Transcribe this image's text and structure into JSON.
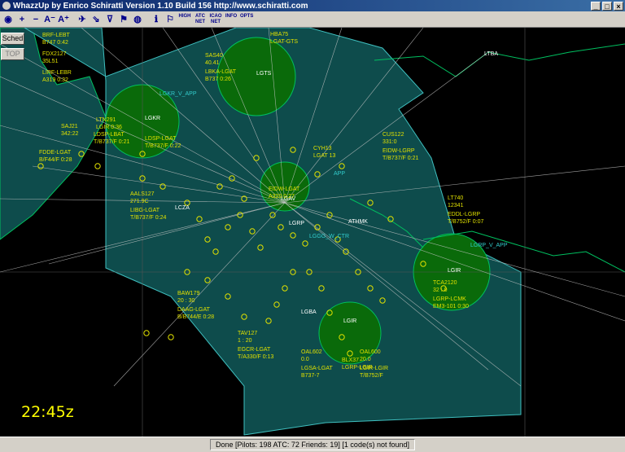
{
  "window": {
    "title": "WhazzUp by Enrico Schiratti Version 1.10 Build 156 http://www.schiratti.com"
  },
  "toolbar": {
    "buttons": [
      {
        "name": "globe-icon",
        "glyph": "◉"
      },
      {
        "name": "zoom-in-icon",
        "glyph": "+"
      },
      {
        "name": "zoom-out-icon",
        "glyph": "−"
      },
      {
        "name": "font-smaller-icon",
        "glyph": "A⁻"
      },
      {
        "name": "font-larger-icon",
        "glyph": "A⁺"
      },
      {
        "name": "airplane-icon",
        "glyph": "✈"
      },
      {
        "name": "route-icon",
        "glyph": "⇘"
      },
      {
        "name": "filter-icon",
        "glyph": "⊽"
      },
      {
        "name": "flag-icon",
        "glyph": "⚑"
      },
      {
        "name": "world-icon",
        "glyph": "◍"
      },
      {
        "name": "info-icon",
        "glyph": "ℹ"
      },
      {
        "name": "flights-icon",
        "glyph": "⚐"
      }
    ],
    "text_buttons": [
      "HIGH",
      "ATC NET",
      "ICAO NET",
      "INFO",
      "OPTS"
    ]
  },
  "side": {
    "sched": "Sched",
    "top": "TOP"
  },
  "clock": "22:45z",
  "status": "Done [Pilots: 198  ATC: 72  Friends: 19] [1 code(s) not found]",
  "colors": {
    "water": "#000000",
    "fir": "#0e4c4c",
    "firBorder": "#3fbfbf",
    "coast": "#00c060",
    "tma": "#0a6a0a",
    "label": "#e0e000",
    "atc": "#33cccc",
    "white": "#ffffff"
  },
  "stations": [
    {
      "id": "LGTS",
      "label": "LGTS"
    },
    {
      "id": "LGKR_V_APP",
      "label": "LGKR_V_APP"
    },
    {
      "id": "LGKR",
      "label": "LGKR"
    },
    {
      "id": "LGRP_V_APP",
      "label": "LGRP_V_APP"
    },
    {
      "id": "LGIR",
      "label": "LGIR"
    },
    {
      "id": "LGTBA",
      "label": "LTBA"
    },
    {
      "id": "LCZA",
      "label": "LCZA"
    },
    {
      "id": "ATHMK",
      "label": "ATHMK"
    },
    {
      "id": "LGGG_W_CTR",
      "label": "LGGG_W_CTR"
    },
    {
      "id": "LGAV",
      "label": "LGAV"
    },
    {
      "id": "LGBA",
      "label": "LGBA"
    },
    {
      "id": "LGIR2",
      "label": "LGIR"
    },
    {
      "id": "LGRP",
      "label": "LGRP"
    },
    {
      "id": "APP",
      "label": "APP"
    }
  ],
  "flights": [
    {
      "l1": "BRF-LEBT",
      "l2": "B747 0:42"
    },
    {
      "l1": "FDX2127",
      "l2": "35L51"
    },
    {
      "l1": "LIRF-LEBR",
      "l2": "A319 0:32"
    },
    {
      "l1": "SAJ21",
      "l2": "342:22"
    },
    {
      "l1": "LDSP-LBAT",
      "l2": "T/B737/F 0:21"
    },
    {
      "l1": "FDDE-LGAT",
      "l2": "B/F44/F 0:28"
    },
    {
      "l1": "LTN291",
      "l2": "LGIR 0:36"
    },
    {
      "l1": "LDSP-LGAT",
      "l2": "T/B737/F 0:22"
    },
    {
      "l1": "AALS127",
      "l2": "271.9C"
    },
    {
      "l1": "LIBG-LGAT",
      "l2": "T/B737/F 0:24"
    },
    {
      "l1": "BAW179",
      "l2": "20 : 30"
    },
    {
      "l1": "DAAG-LGAT",
      "l2": "B/B744/E 0:28"
    },
    {
      "l1": "TAV127",
      "l2": "1 : 20"
    },
    {
      "l1": "EGCR-LGAT",
      "l2": "T/A330/F 0:13"
    },
    {
      "l1": "CUS122",
      "l2": "331:0"
    },
    {
      "l1": "EIDW-LGRP",
      "l2": "T/B737/F 0:21"
    },
    {
      "l1": "LT740",
      "l2": "12341"
    },
    {
      "l1": "EDDL-LGRP",
      "l2": "T/B752/F 0:07"
    },
    {
      "l1": "TCA2120",
      "l2": "32 : 0"
    },
    {
      "l1": "LGRP-LCMK",
      "l2": "EM3-101 0:30"
    },
    {
      "l1": "OAL600",
      "l2": "20.0"
    },
    {
      "l1": "LGIR-LGIR",
      "l2": "T/B752/F"
    },
    {
      "l1": "OAL602",
      "l2": "0.0"
    },
    {
      "l1": "LGSA-LGAT",
      "l2": "B737-7"
    },
    {
      "l1": "BLX37",
      "l2": "LGRP-LGIR"
    },
    {
      "l1": "SAS40",
      "l2": "40.41"
    },
    {
      "l1": "LBKA-LGAT",
      "l2": "B737 0:26"
    },
    {
      "l1": "HBA75",
      "l2": "LGAT-GTS"
    },
    {
      "l1": "EIDW-LGAT",
      "l2": "A320 0:27"
    },
    {
      "l1": "CYH13",
      "l2": "LGAT 13"
    }
  ]
}
